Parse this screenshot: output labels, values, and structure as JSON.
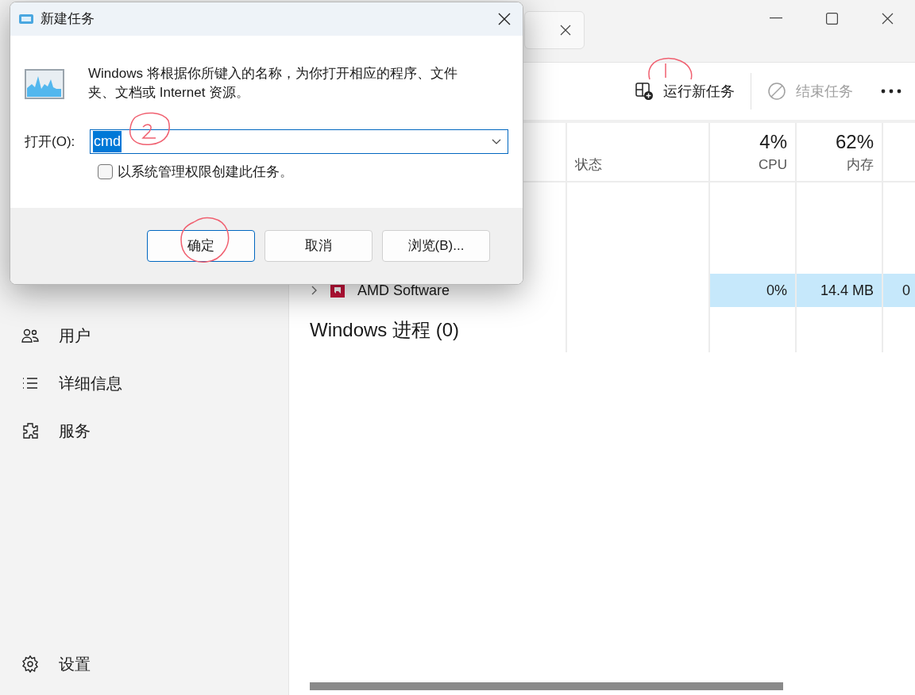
{
  "task_manager": {
    "toolbar": {
      "run_new_task": "运行新任务",
      "end_task": {
        "label": "结束任务",
        "disabled": true
      }
    },
    "sidebar": {
      "items": [
        {
          "label": "用户",
          "kind": "users"
        },
        {
          "label": "详细信息",
          "kind": "list"
        },
        {
          "label": "服务",
          "kind": "puzzle"
        }
      ],
      "settings": {
        "label": "设置",
        "kind": "gear"
      }
    },
    "table": {
      "columns": [
        {
          "label": "状态"
        },
        {
          "percent": "4%",
          "label": "CPU"
        },
        {
          "percent": "62%",
          "label": "内存"
        }
      ],
      "rows": [
        {
          "name": "AMD Software",
          "cpu": "0%",
          "memory": "14.4 MB",
          "column_5": "0",
          "selected": true
        }
      ],
      "group": "Windows 进程 (0)"
    }
  },
  "dialog": {
    "title": "新建任务",
    "message": "Windows 将根据你所键入的名称，为你打开相应的程序、文件夹、文档或 Internet 资源。",
    "open_label": "打开(O):",
    "open_value": "cmd",
    "value_selected": true,
    "admin_checkbox": {
      "label": "以系统管理权限创建此任务。",
      "checked": false
    },
    "buttons": [
      {
        "label": "确定",
        "default": true
      },
      {
        "label": "取消",
        "default": false
      },
      {
        "label": "浏览(B)...",
        "default": false
      }
    ]
  }
}
